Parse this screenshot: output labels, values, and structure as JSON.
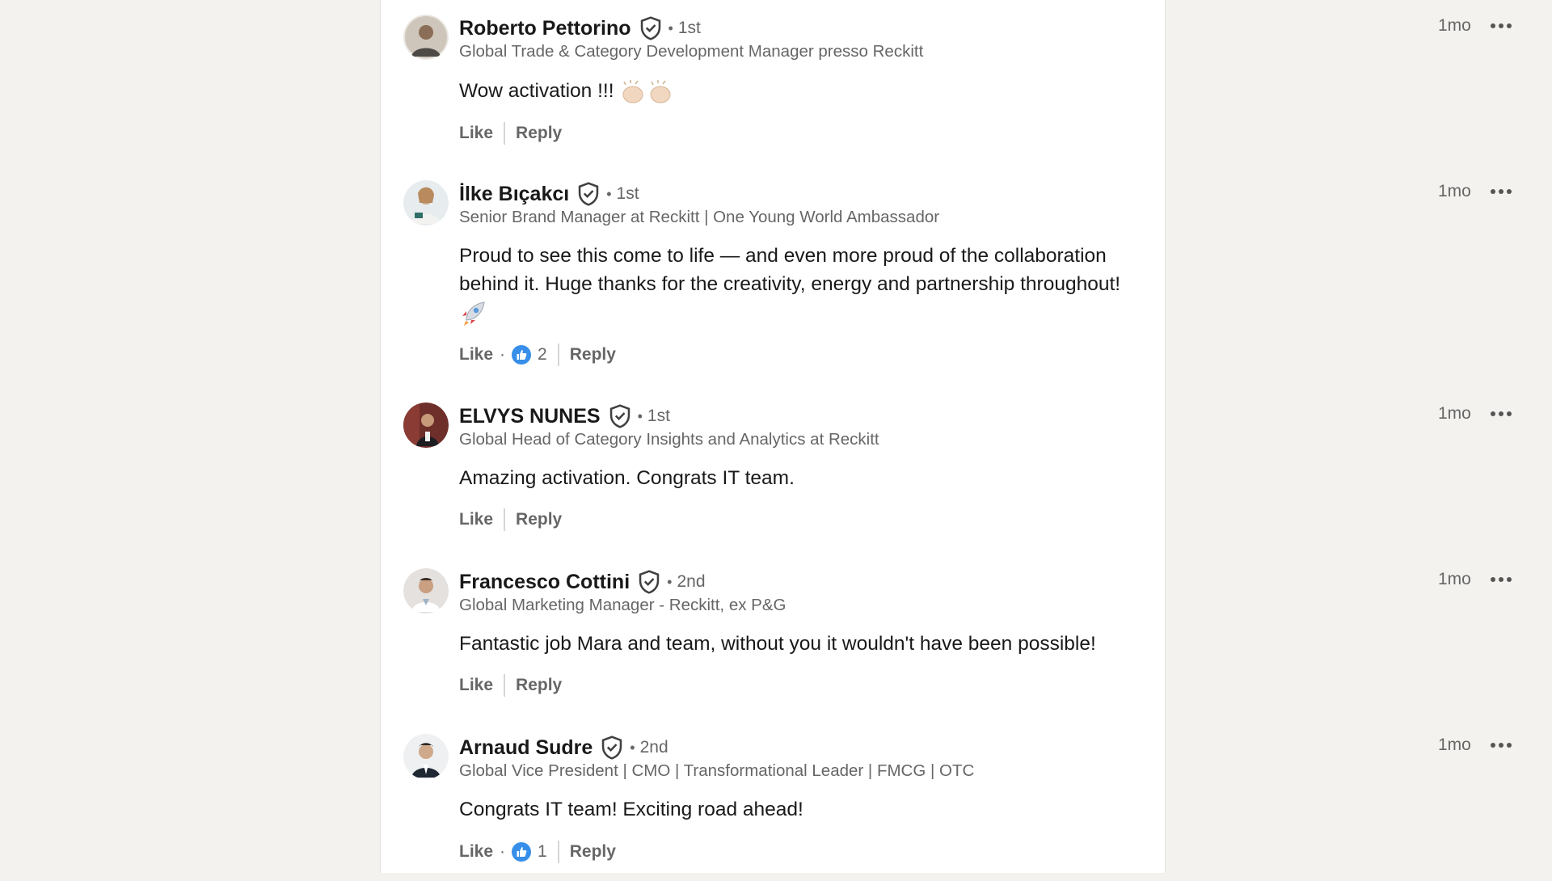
{
  "comments": [
    {
      "name": "Roberto Pettorino",
      "degree": "1st",
      "headline": "Global Trade & Category Development Manager presso Reckitt",
      "time": "1mo",
      "text": "Wow activation !!!",
      "emoji": "clapping-hands",
      "like_label": "Like",
      "reply_label": "Reply",
      "reaction_count": null,
      "avatar_color": "#8a7a6a"
    },
    {
      "name": "İlke Bıçakcı",
      "degree": "1st",
      "headline": "Senior Brand Manager at Reckitt | One Young World Ambassador",
      "time": "1mo",
      "text": "Proud to see this come to life — and even more proud of the collaboration behind it. Huge thanks for the creativity, energy and partnership throughout!",
      "emoji": "rocket",
      "like_label": "Like",
      "reply_label": "Reply",
      "reaction_count": "2",
      "avatar_color": "#c9a887"
    },
    {
      "name": "ELVYS NUNES",
      "degree": "1st",
      "headline": "Global Head of Category Insights and Analytics at Reckitt",
      "time": "1mo",
      "text": "Amazing activation. Congrats IT team.",
      "emoji": null,
      "like_label": "Like",
      "reply_label": "Reply",
      "reaction_count": null,
      "avatar_color": "#6e2e2a"
    },
    {
      "name": "Francesco Cottini",
      "degree": "2nd",
      "headline": "Global Marketing Manager - Reckitt, ex P&G",
      "time": "1mo",
      "text": "Fantastic job Mara and team, without you it wouldn't have been possible!",
      "emoji": null,
      "like_label": "Like",
      "reply_label": "Reply",
      "reaction_count": null,
      "avatar_color": "#b9b3ad"
    },
    {
      "name": "Arnaud Sudre",
      "degree": "2nd",
      "headline": "Global Vice President | CMO | Transformational Leader | FMCG | OTC",
      "time": "1mo",
      "text": "Congrats IT team! Exciting road ahead!",
      "emoji": null,
      "like_label": "Like",
      "reply_label": "Reply",
      "reaction_count": "1",
      "avatar_color": "#d7d9dc"
    }
  ],
  "colors": {
    "background": "#f3f2ef",
    "panel": "#ffffff",
    "name": "#191919",
    "secondary": "#666666",
    "like_blue": "#378fe9"
  }
}
